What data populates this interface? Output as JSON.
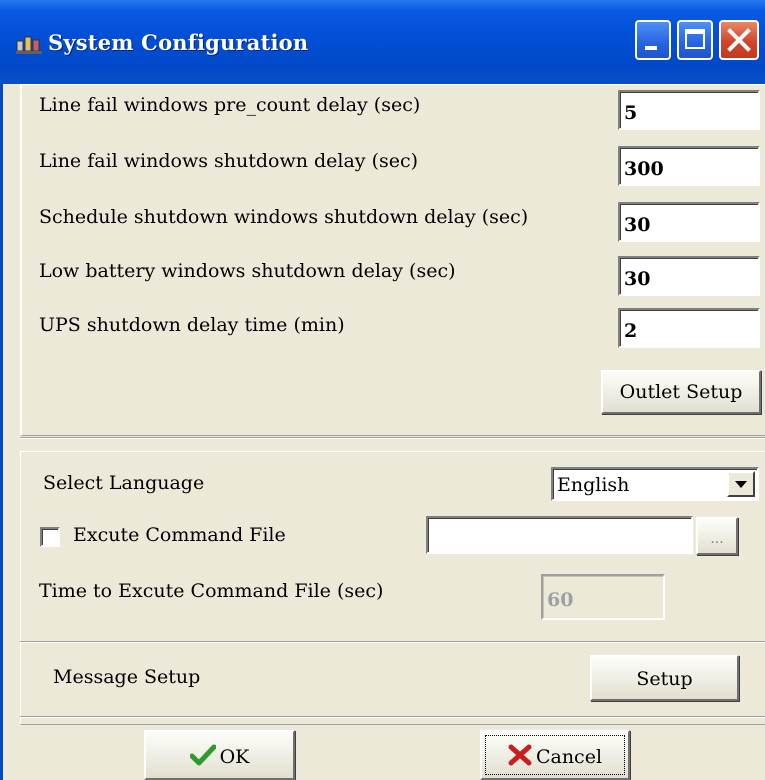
{
  "window": {
    "title": "System Configuration"
  },
  "titlebar_buttons": {
    "minimize": "minimize-icon",
    "maximize": "maximize-icon",
    "close": "close-icon"
  },
  "delays": {
    "line_fail_precount": {
      "label": "Line fail windows pre_count  delay (sec)",
      "value": "5"
    },
    "line_fail_shutdown": {
      "label": "Line fail windows shutdown delay (sec)",
      "value": "300"
    },
    "schedule_shutdown": {
      "label": "Schedule shutdown windows shutdown delay (sec)",
      "value": "30"
    },
    "low_battery": {
      "label": "Low battery windows shutdown delay (sec)",
      "value": "30"
    },
    "ups_shutdown": {
      "label": "UPS shutdown delay time (min)",
      "value": "2"
    }
  },
  "outlet_setup_label": "Outlet Setup",
  "language": {
    "label": "Select Language",
    "selected": "English"
  },
  "command_file": {
    "checkbox_label": "Excute Command File",
    "checked": false,
    "path": "",
    "browse_label": "..."
  },
  "execute_time": {
    "label": "Time to Excute Command File (sec)",
    "value": "60"
  },
  "message_setup": {
    "label": "Message Setup",
    "button_label": "Setup"
  },
  "footer": {
    "ok_label": "OK",
    "cancel_label": "Cancel"
  },
  "colors": {
    "titlebar": "#0350D8",
    "face": "#ECE9D8",
    "ok_check": "#2E9B2E",
    "cancel_x": "#C81E1E"
  }
}
